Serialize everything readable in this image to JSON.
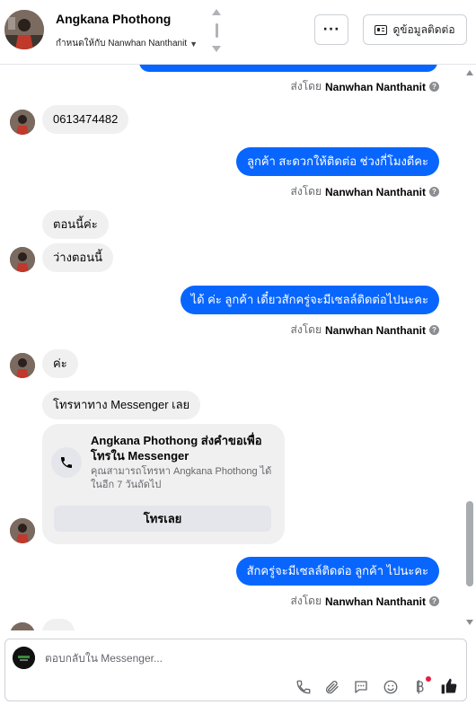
{
  "header": {
    "contact_name": "Angkana Phothong",
    "assign_label": "กำหนดให้กับ Nanwhan Nanthanit",
    "more_label": "···",
    "view_contact_label": "ดูข้อมูลติดต่อ"
  },
  "messages": {
    "sent_by_prefix": "ส่งโดย",
    "sender_name": "Nanwhan Nanthanit",
    "info_glyph": "?",
    "m1": "0613474482",
    "m2": "ลูกค้า สะดวกให้ติดต่อ ช่วงกี่โมงดีคะ",
    "m3": "ตอนนี้ค่ะ",
    "m4": "ว่างตอนนี้",
    "m5": "ได้ ค่ะ ลูกค้า เดี๋ยวสักครู่จะมีเซลล์ติดต่อไปนะคะ",
    "m6": "ค่ะ",
    "m7": "โทรหาทาง Messenger เลย",
    "m8": "สักครู่จะมีเซลล์ติดต่อ ลูกค้า ไปนะคะ"
  },
  "call_card": {
    "title": "Angkana Phothong ส่งคำขอเพื่อโทรใน Messenger",
    "description": "คุณสามารถโทรหา Angkana Phothong ได้ในอีก 7 วันถัดไป",
    "button_label": "โทรเลย"
  },
  "composer": {
    "placeholder": "ตอบกลับใน Messenger..."
  },
  "colors": {
    "outgoing_bubble": "#0866ff",
    "incoming_bubble": "#f0f0f0",
    "like_icon": "#1c1e21",
    "notification_dot": "#e41e3f"
  },
  "icons": [
    "chevron-up-icon",
    "chevron-down-icon",
    "more-icon",
    "id-card-icon",
    "info-icon",
    "phone-icon",
    "attachment-icon",
    "saved-replies-icon",
    "emoji-icon",
    "currency-icon",
    "thumbs-up-icon"
  ]
}
